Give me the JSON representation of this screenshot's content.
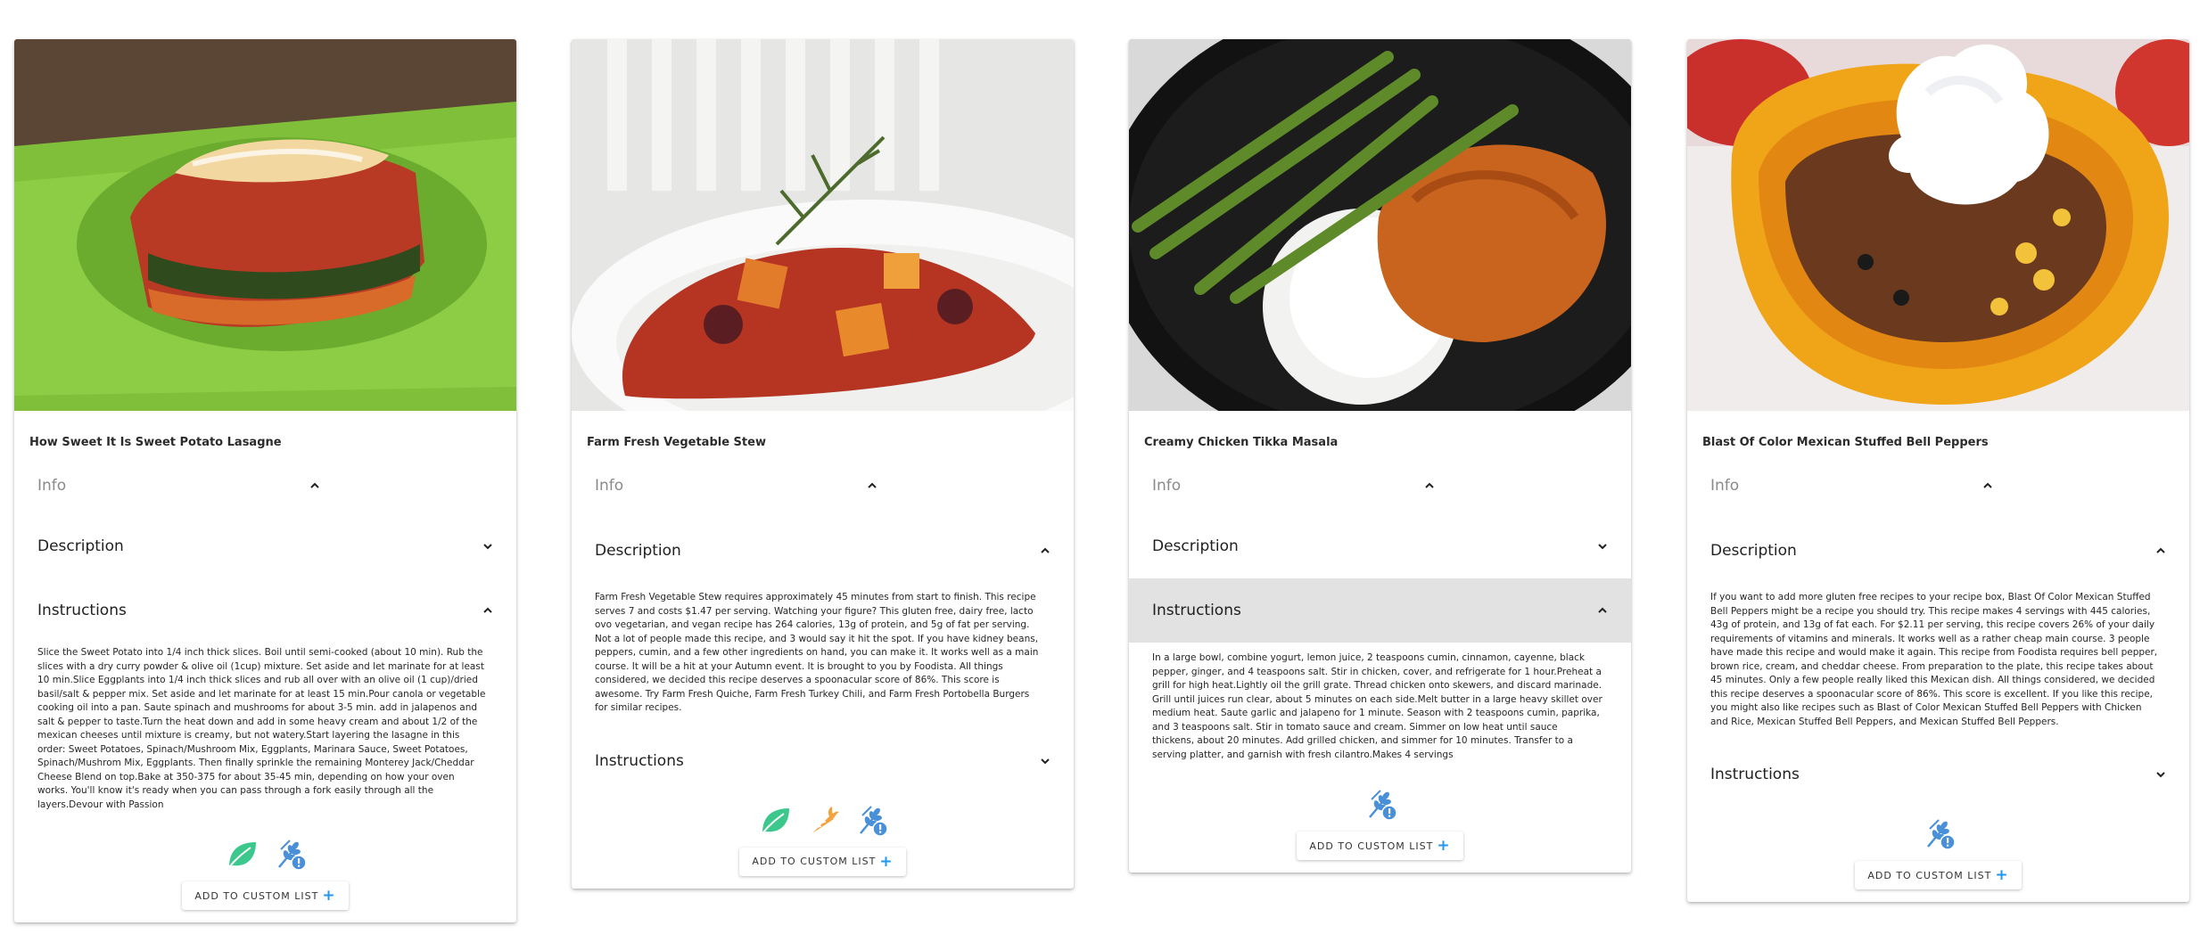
{
  "cards": [
    {
      "title": "How Sweet It Is Sweet Potato Lasagne",
      "info_label": "Info",
      "description_label": "Description",
      "instructions_label": "Instructions",
      "instructions_text": "Slice the Sweet Potato into 1/4 inch thick slices. Boil until semi-cooked (about 10 min). Rub the slices with a dry curry powder & olive oil (1cup) mixture. Set aside and let marinate for at least 10 min.Slice Eggplants into 1/4 inch thick slices and rub all over with an olive oil (1 cup)/dried basil/salt & pepper mix. Set aside and let marinate for at least 15 min.Pour canola or vegetable cooking oil into a pan. Saute spinach and mushrooms for about 3-5 min. add in jalapenos and salt & pepper to taste.Turn the heat down and add in some heavy cream and about 1/2 of the mexican cheeses until mixture is creamy, but not watery.Start layering the lasagne in this order: Sweet Potatoes, Spinach/Mushroom Mix, Eggplants, Marinara Sauce, Sweet Potatoes, Spinach/Mushrom Mix, Eggplants. Then finally sprinkle the remaining Monterey Jack/Cheddar Cheese Blend on top.Bake at 350-375 for about 35-45 min, depending on how your oven works. You'll know it's ready when you can pass through a fork easily through all the layers.Devour with Passion",
      "add_label": "ADD TO CUSTOM LIST",
      "badges": [
        "vegan-leaf-icon",
        "gluten-free-wheat-alert-icon"
      ]
    },
    {
      "title": "Farm Fresh Vegetable Stew",
      "info_label": "Info",
      "description_label": "Description",
      "description_text": "Farm Fresh Vegetable Stew requires approximately 45 minutes from start to finish. This recipe serves 7 and costs $1.47 per serving. Watching your figure? This gluten free, dairy free, lacto ovo vegetarian, and vegan recipe has 264 calories, 13g of protein, and 5g of fat per serving. Not a lot of people made this recipe, and 3 would say it hit the spot. If you have kidney beans, peppers, cumin, and a few other ingredients on hand, you can make it. It works well as a main course. It will be a hit at your Autumn event. It is brought to you by Foodista. All things considered, we decided this recipe deserves a spoonacular score of 86%. This score is awesome. Try Farm Fresh Quiche, Farm Fresh Turkey Chili, and Farm Fresh Portobella Burgers for similar recipes.",
      "instructions_label": "Instructions",
      "add_label": "ADD TO CUSTOM LIST",
      "badges": [
        "vegan-leaf-icon",
        "vegetarian-carrot-icon",
        "gluten-free-wheat-alert-icon"
      ]
    },
    {
      "title": "Creamy Chicken Tikka Masala",
      "info_label": "Info",
      "description_label": "Description",
      "instructions_label": "Instructions",
      "instructions_text": "In a large bowl, combine yogurt, lemon juice, 2 teaspoons cumin, cinnamon, cayenne, black pepper, ginger, and 4 teaspoons salt. Stir in chicken, cover, and refrigerate for 1 hour.Preheat a grill for high heat.Lightly oil the grill grate. Thread chicken onto skewers, and discard marinade. Grill until juices run clear, about 5 minutes on each side.Melt butter in a large heavy skillet over medium heat. Saute garlic and jalapeno for 1 minute. Season with 2 teaspoons cumin, paprika, and 3 teaspoons salt. Stir in tomato sauce and cream. Simmer on low heat until sauce thickens, about 20 minutes. Add grilled chicken, and simmer for 10 minutes. Transfer to a serving platter, and garnish with fresh cilantro.Makes 4 servings",
      "add_label": "ADD TO CUSTOM LIST",
      "badges": [
        "gluten-free-wheat-alert-icon"
      ]
    },
    {
      "title": "Blast Of Color Mexican Stuffed Bell Peppers",
      "info_label": "Info",
      "description_label": "Description",
      "description_text": "If you want to add more gluten free recipes to your recipe box, Blast Of Color Mexican Stuffed Bell Peppers might be a recipe you should try. This recipe makes 4 servings with 445 calories, 43g of protein, and 13g of fat each. For $2.11 per serving, this recipe covers 26% of your daily requirements of vitamins and minerals. It works well as a rather cheap main course. 3 people have made this recipe and would make it again. This recipe from Foodista requires bell pepper, brown rice, cream, and cheddar cheese. From preparation to the plate, this recipe takes about 45 minutes. Only a few people really liked this Mexican dish. All things considered, we decided this recipe deserves a spoonacular score of 86%. This score is excellent. If you like this recipe, you might also like recipes such as Blast of Color Mexican Stuffed Bell Peppers with Chicken and Rice, Mexican Stuffed Bell Peppers, and Mexican Stuffed Bell Peppers.",
      "instructions_label": "Instructions",
      "add_label": "ADD TO CUSTOM LIST",
      "badges": [
        "gluten-free-wheat-alert-icon"
      ]
    }
  ],
  "colors": {
    "leaf": "#3cc88c",
    "carrot": "#f4a23c",
    "wheat_blue": "#4a90d9",
    "plus": "#2196f3"
  }
}
